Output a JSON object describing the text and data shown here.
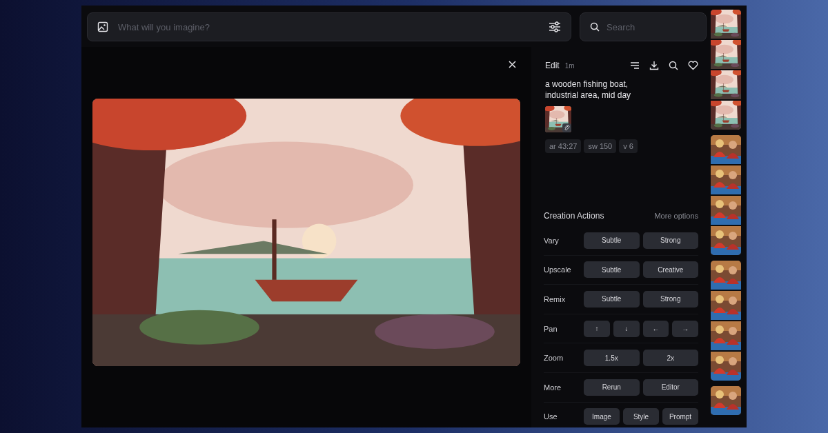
{
  "prompt_bar": {
    "placeholder": "What will you imagine?"
  },
  "search": {
    "placeholder": "Search"
  },
  "detail": {
    "title": "Edit",
    "age": "1m",
    "prompt": "a wooden fishing boat, industrial area, mid day",
    "params": [
      "ar 43:27",
      "sw 150",
      "v 6"
    ]
  },
  "creation_actions": {
    "title": "Creation Actions",
    "more": "More options",
    "rows": [
      {
        "label": "Vary",
        "buttons": [
          "Subtle",
          "Strong"
        ]
      },
      {
        "label": "Upscale",
        "buttons": [
          "Subtle",
          "Creative"
        ]
      },
      {
        "label": "Remix",
        "buttons": [
          "Subtle",
          "Strong"
        ]
      },
      {
        "label": "Pan",
        "buttons": [
          "↑",
          "↓",
          "←",
          "→"
        ]
      },
      {
        "label": "Zoom",
        "buttons": [
          "1.5x",
          "2x"
        ]
      },
      {
        "label": "More",
        "buttons": [
          "Rerun",
          "Editor"
        ]
      },
      {
        "label": "Use",
        "buttons": [
          "Image",
          "Style",
          "Prompt"
        ]
      }
    ]
  },
  "history": [
    {
      "thumbnails": [
        {
          "kind": "landscape"
        },
        {
          "kind": "landscape"
        },
        {
          "kind": "landscape"
        },
        {
          "kind": "landscape"
        }
      ]
    },
    {
      "thumbnails": [
        {
          "kind": "figures"
        },
        {
          "kind": "figures"
        },
        {
          "kind": "figures"
        },
        {
          "kind": "figures"
        }
      ]
    },
    {
      "thumbnails": [
        {
          "kind": "figures"
        },
        {
          "kind": "figures"
        },
        {
          "kind": "figures"
        },
        {
          "kind": "figures"
        }
      ]
    },
    {
      "thumbnails": [
        {
          "kind": "figures"
        }
      ]
    }
  ]
}
